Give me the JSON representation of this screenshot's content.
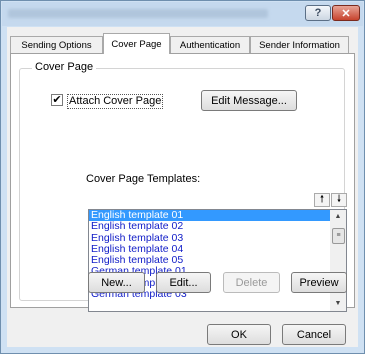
{
  "window": {
    "help_label": "?",
    "close_label": "✕"
  },
  "tabs": [
    {
      "label": "Sending Options",
      "active": false
    },
    {
      "label": "Cover Page",
      "active": true
    },
    {
      "label": "Authentication",
      "active": false
    },
    {
      "label": "Sender Information",
      "active": false
    }
  ],
  "cover_page": {
    "group_title": "Cover Page",
    "attach_checkbox": {
      "label": "Attach Cover Page",
      "checked": true,
      "mark": "✔"
    },
    "edit_message_label": "Edit Message...",
    "templates_label": "Cover Page Templates:",
    "move_up_icon": "🠕",
    "move_down_icon": "🠗",
    "templates": [
      "English template 01",
      "English template 02",
      "English template 03",
      "English template 04",
      "English template 05",
      "German template 01",
      "German template 02",
      "German template 03"
    ],
    "selected_index": 0,
    "buttons": {
      "new": "New...",
      "edit": "Edit...",
      "delete": "Delete",
      "preview": "Preview"
    }
  },
  "dialog_buttons": {
    "ok": "OK",
    "cancel": "Cancel"
  },
  "icons": {
    "scroll_up": "▲",
    "scroll_down": "▼",
    "scroll_thumb": "≡"
  },
  "colors": {
    "selection": "#3399ff",
    "list_text": "#1420c8",
    "titlebar": "#c5d9ee",
    "close_button": "#c7432d"
  }
}
